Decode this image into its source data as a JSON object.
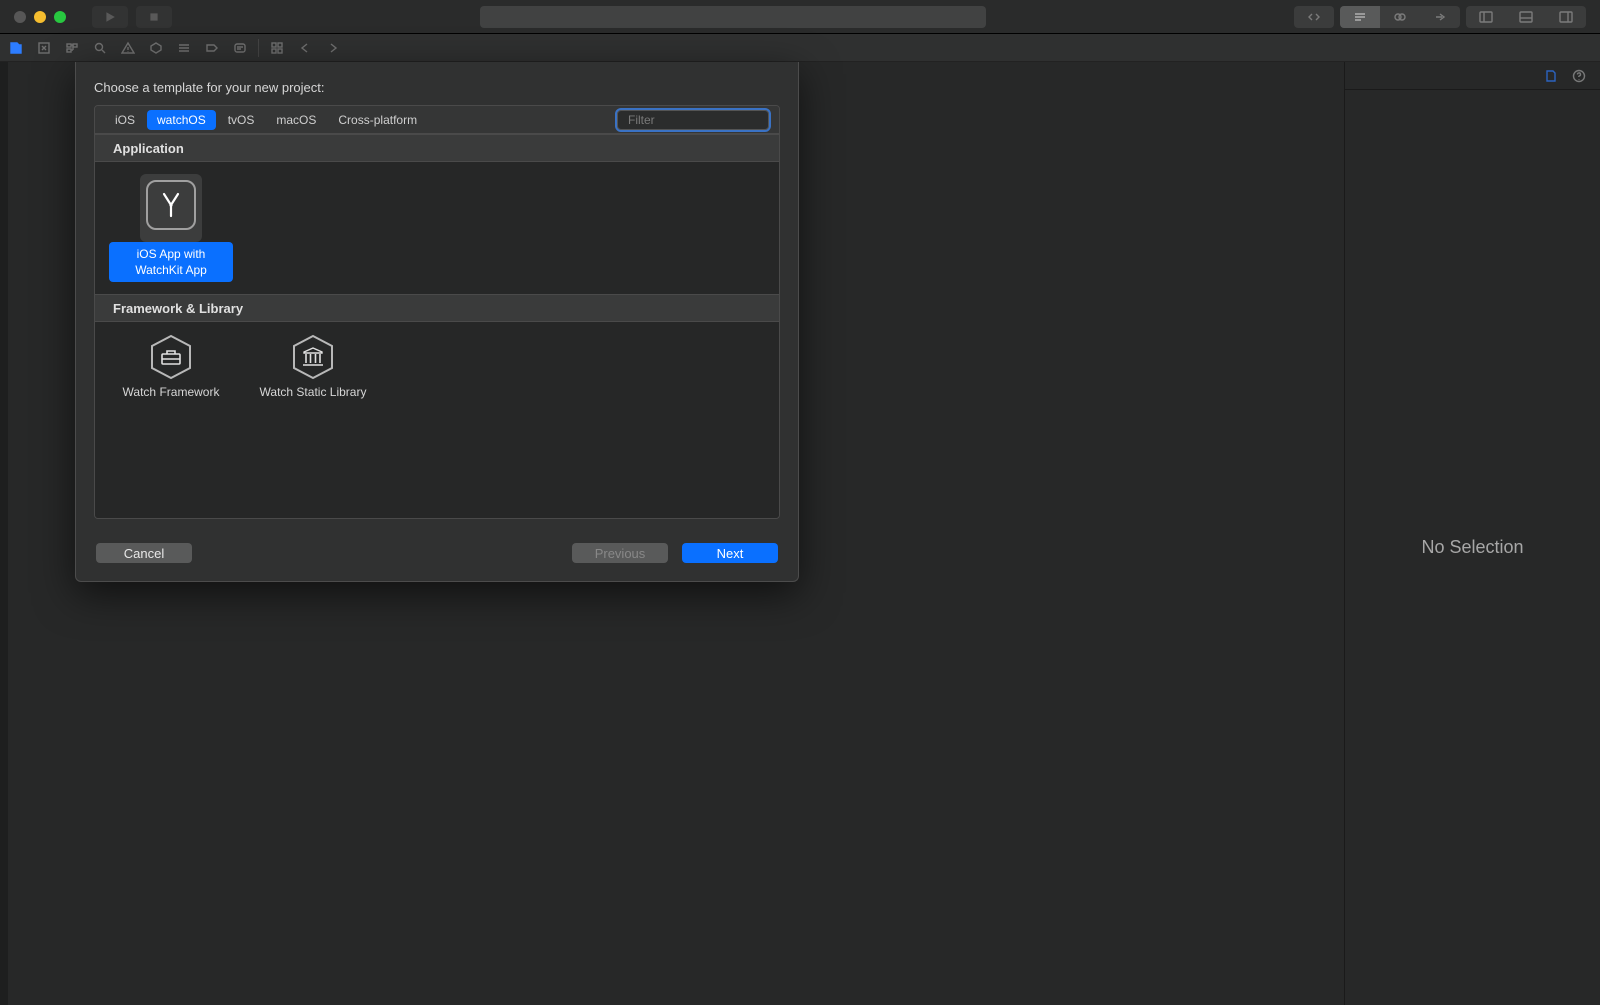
{
  "sheet": {
    "title": "Choose a template for your new project:",
    "platforms": [
      "iOS",
      "watchOS",
      "tvOS",
      "macOS",
      "Cross-platform"
    ],
    "active_platform_index": 1,
    "filter_placeholder": "Filter",
    "sections": [
      {
        "name": "Application",
        "templates": [
          {
            "label": "iOS App with WatchKit App",
            "icon": "watch-hands",
            "selected": true
          }
        ]
      },
      {
        "name": "Framework & Library",
        "templates": [
          {
            "label": "Watch Framework",
            "icon": "toolbox"
          },
          {
            "label": "Watch Static Library",
            "icon": "columns"
          }
        ]
      }
    ],
    "buttons": {
      "cancel": "Cancel",
      "previous": "Previous",
      "next": "Next"
    }
  },
  "right_panel": {
    "empty_text": "No Selection"
  }
}
